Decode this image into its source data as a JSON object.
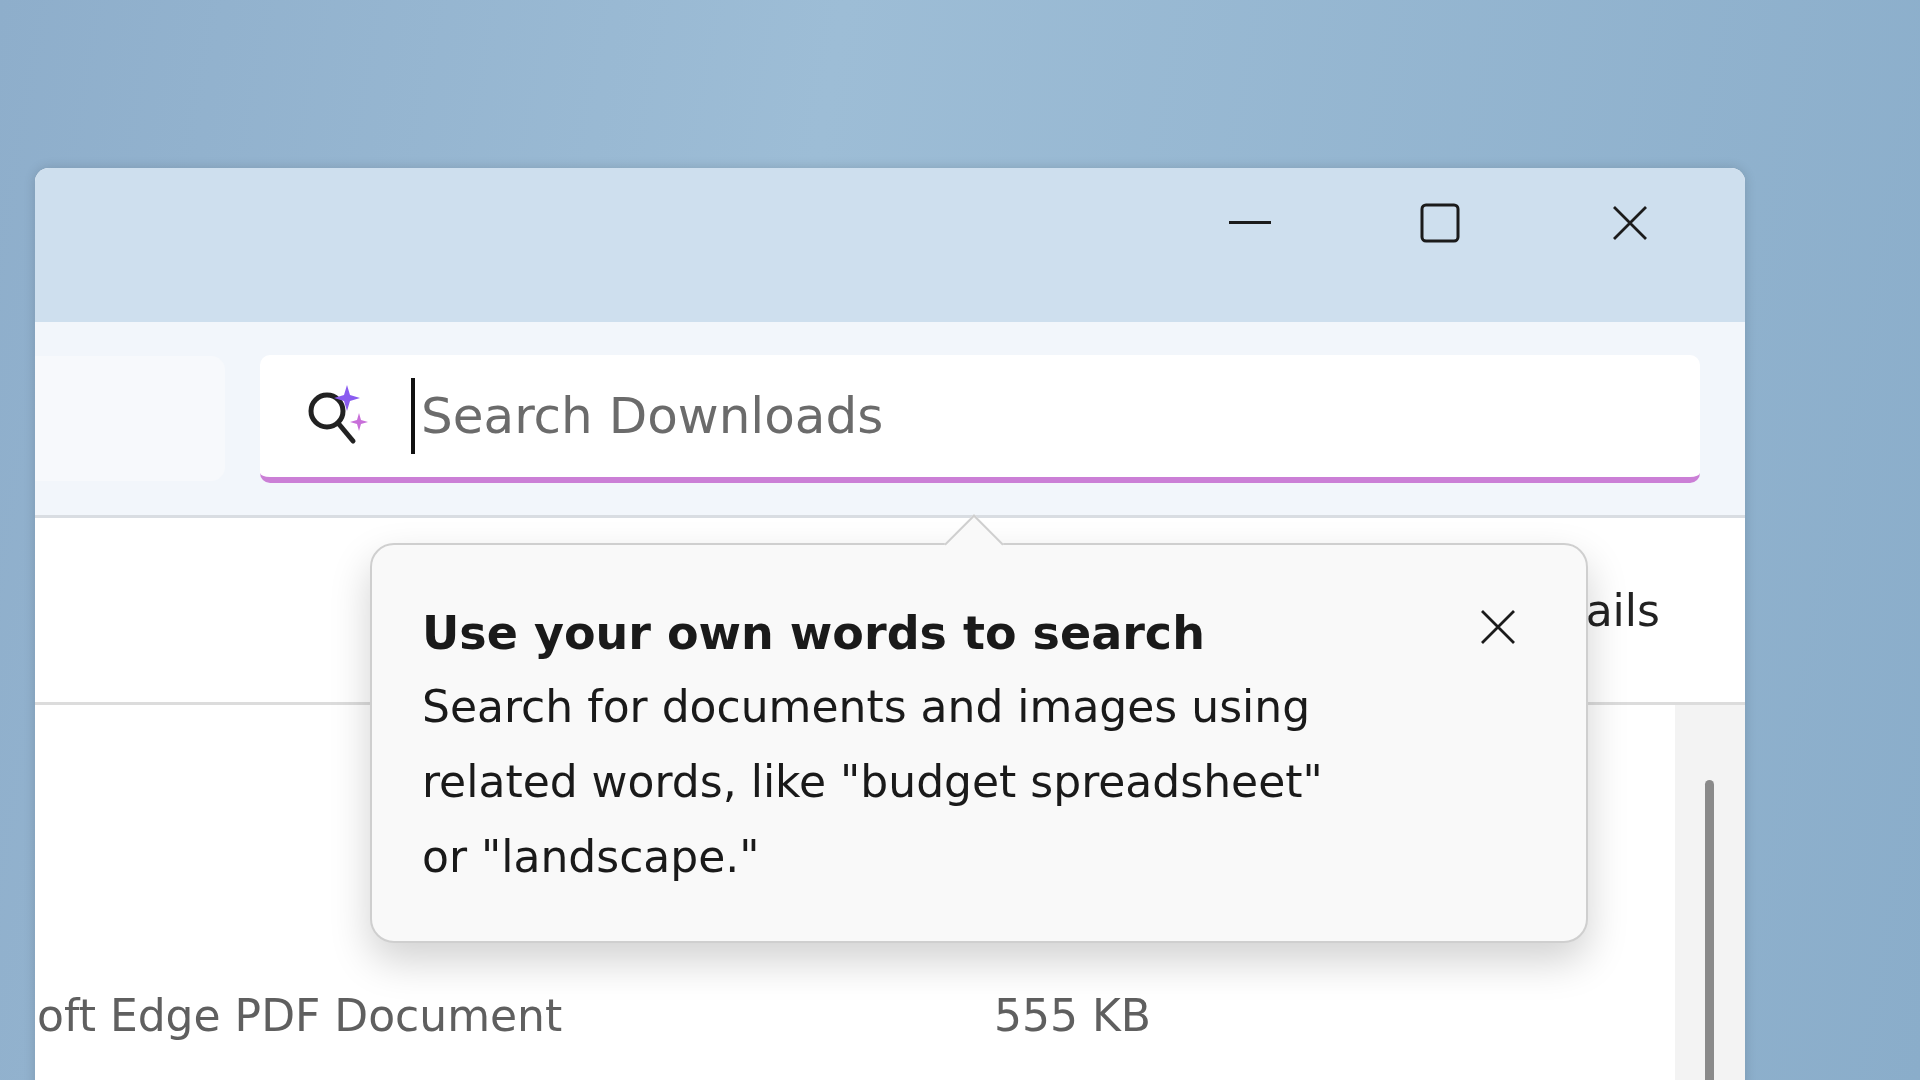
{
  "window": {
    "controls": [
      {
        "kind": "minimize"
      },
      {
        "kind": "maximize"
      },
      {
        "kind": "close"
      }
    ]
  },
  "search": {
    "placeholder": "Search Downloads",
    "focused": true
  },
  "command_bar": {
    "partial_label": "ails"
  },
  "rows": [
    {
      "type": "oft Edge PDF Document",
      "size": "555 KB"
    }
  ],
  "tooltip": {
    "title": "Use your own words to search",
    "body": "Search for documents and images using related words, like \"budget spreadsheet\" or \"landscape.\""
  }
}
